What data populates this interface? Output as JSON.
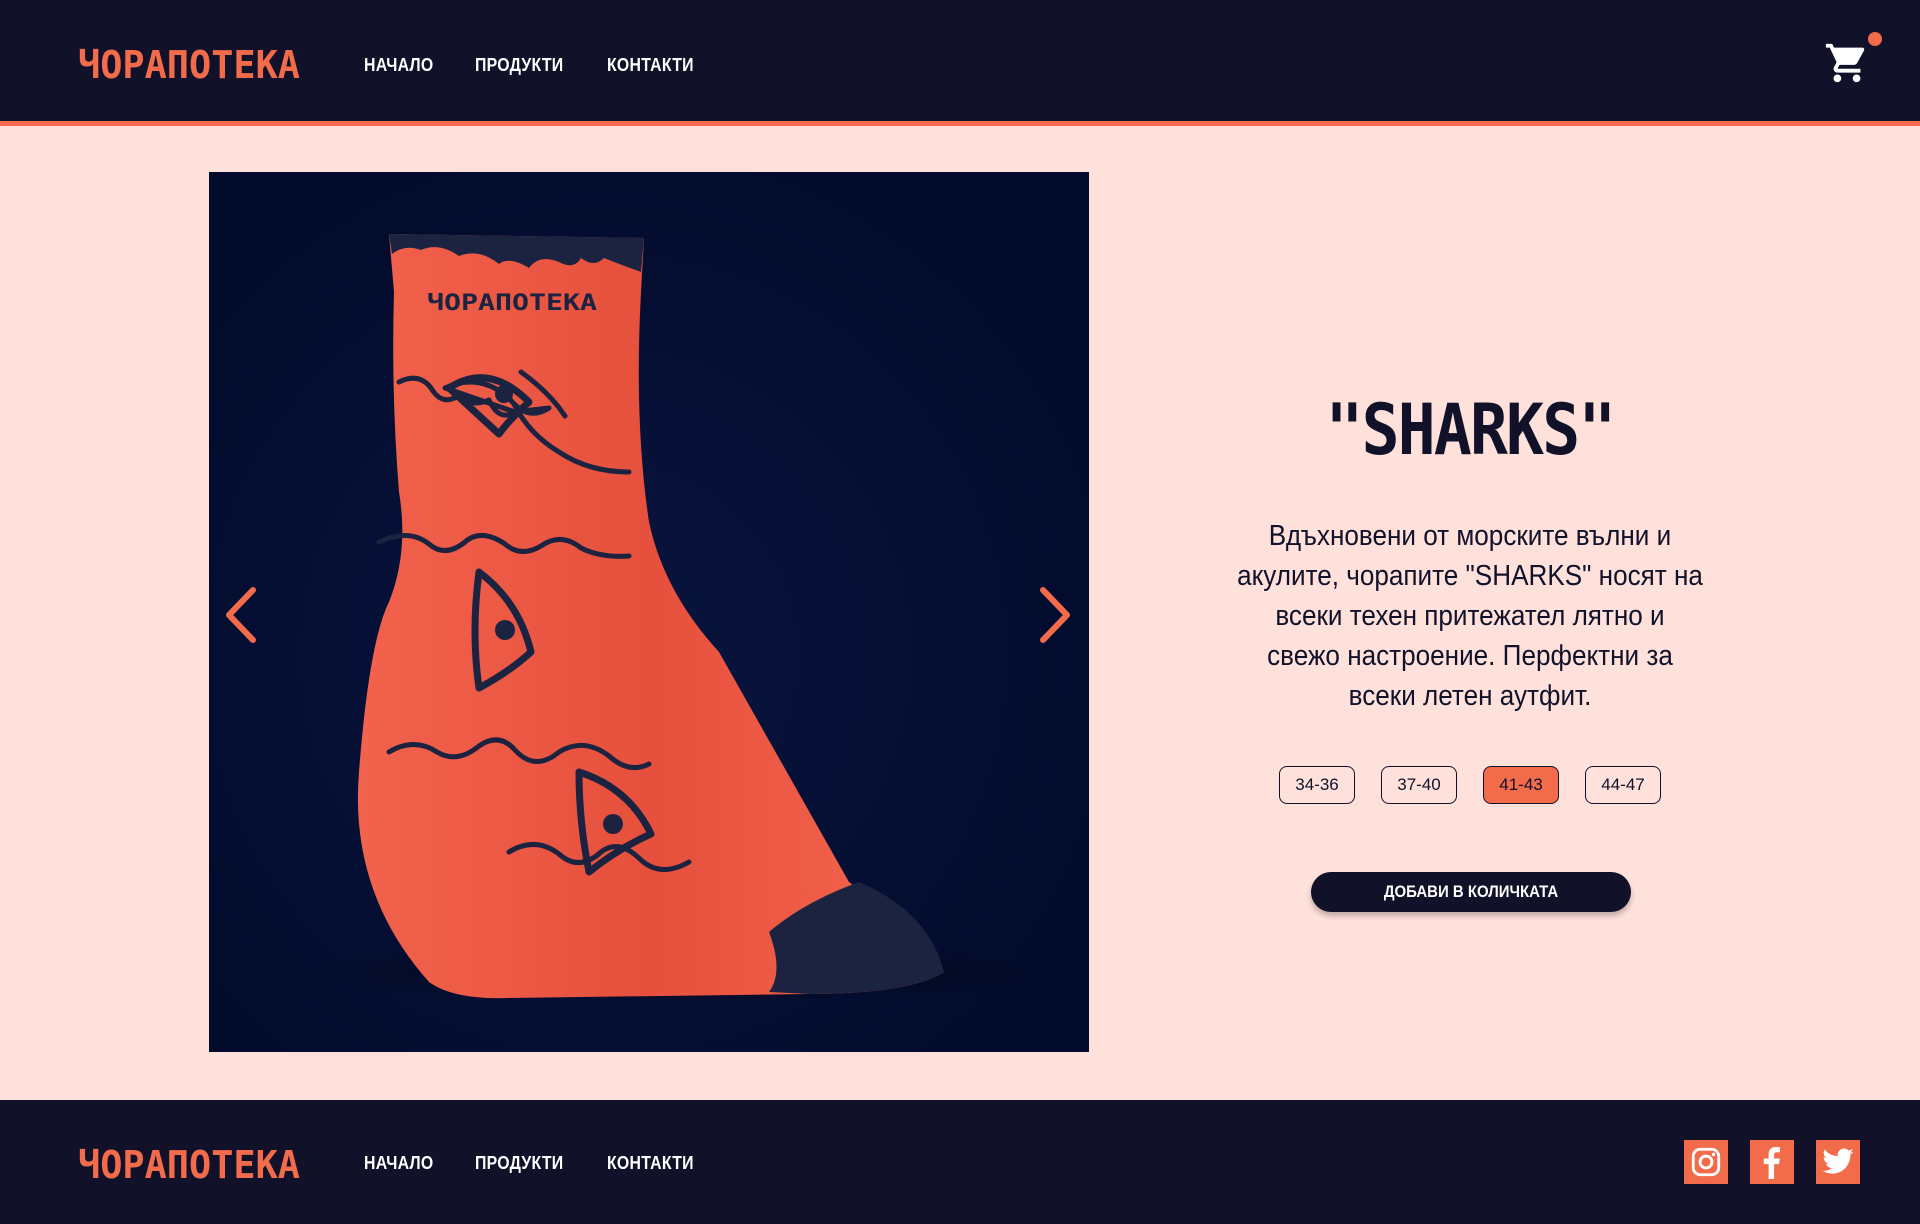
{
  "brand": {
    "name": "ЧОРАПОТЕКА",
    "accent": "#f26b4a",
    "dark": "#11112a",
    "background": "#ffe1dc"
  },
  "nav": {
    "items": [
      {
        "label": "НАЧАЛО"
      },
      {
        "label": "ПРОДУКТИ"
      },
      {
        "label": "КОНТАКТИ"
      }
    ]
  },
  "header": {
    "cart_icon": "cart-icon",
    "cart_badge": "dot"
  },
  "product": {
    "title": "\"SHARKS\"",
    "description": "Вдъхновени от морските вълни и акулите, чорапите \"SHARKS\" носят на всеки техен притежател лятно и свежо настроение. Перфектни за всеки летен аутфит.",
    "sizes": [
      {
        "label": "34-36"
      },
      {
        "label": "37-40"
      },
      {
        "label": "41-43",
        "selected": true
      },
      {
        "label": "44-47"
      }
    ],
    "add_button": "ДОБАВИ В КОЛИЧКАТА",
    "image": {
      "logo_text": "ЧОРАПОТЕКА",
      "sock_color": "#ee5a44",
      "background": "#020b2b"
    }
  },
  "footer": {
    "nav": [
      {
        "label": "НАЧАЛО"
      },
      {
        "label": "ПРОДУКТИ"
      },
      {
        "label": "КОНТАКТИ"
      }
    ],
    "social": [
      {
        "icon": "instagram-icon"
      },
      {
        "icon": "facebook-icon"
      },
      {
        "icon": "twitter-icon"
      }
    ]
  }
}
